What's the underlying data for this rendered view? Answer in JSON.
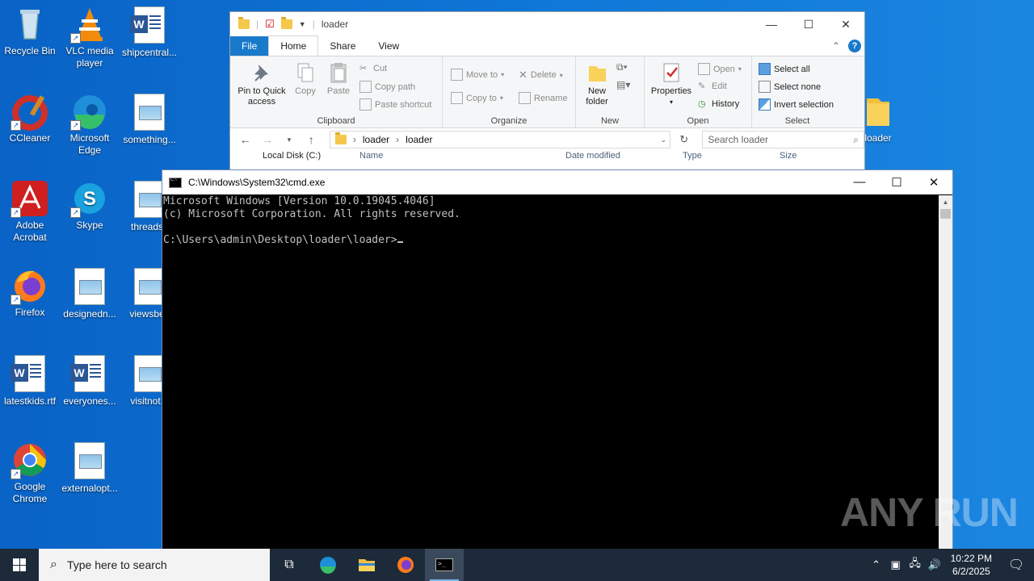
{
  "desktop": {
    "icons": [
      {
        "label": "Recycle Bin",
        "icon": "recycle-bin-icon"
      },
      {
        "label": "VLC media player",
        "icon": "vlc-icon"
      },
      {
        "label": "shipcentral...",
        "icon": "word-doc-icon"
      },
      {
        "label": "CCleaner",
        "icon": "ccleaner-icon"
      },
      {
        "label": "Microsoft Edge",
        "icon": "edge-icon"
      },
      {
        "label": "something...",
        "icon": "image-file-icon"
      },
      {
        "label": "Adobe Acrobat",
        "icon": "acrobat-icon"
      },
      {
        "label": "Skype",
        "icon": "skype-icon"
      },
      {
        "label": "threadsc",
        "icon": "image-file-icon"
      },
      {
        "label": "Firefox",
        "icon": "firefox-icon"
      },
      {
        "label": "designedn...",
        "icon": "image-file-icon"
      },
      {
        "label": "viewsbey",
        "icon": "image-file-icon"
      },
      {
        "label": "latestkids.rtf",
        "icon": "word-doc-icon"
      },
      {
        "label": "everyones...",
        "icon": "word-doc-icon"
      },
      {
        "label": "visitnot.p",
        "icon": "image-file-icon"
      },
      {
        "label": "Google Chrome",
        "icon": "chrome-icon"
      },
      {
        "label": "externalopt...",
        "icon": "image-file-icon"
      },
      {
        "label": "loader",
        "icon": "folder-icon"
      }
    ]
  },
  "explorer": {
    "title": "loader",
    "tabs": {
      "file": "File",
      "home": "Home",
      "share": "Share",
      "view": "View"
    },
    "clipboard": {
      "group": "Clipboard",
      "pin": "Pin to Quick access",
      "copy": "Copy",
      "paste": "Paste",
      "cut": "Cut",
      "copy_path": "Copy path",
      "paste_shortcut": "Paste shortcut"
    },
    "organize": {
      "group": "Organize",
      "move_to": "Move to",
      "copy_to": "Copy to",
      "delete": "Delete",
      "rename": "Rename"
    },
    "new": {
      "group": "New",
      "new_folder": "New folder"
    },
    "open": {
      "group": "Open",
      "properties": "Properties",
      "open": "Open",
      "edit": "Edit",
      "history": "History"
    },
    "select": {
      "group": "Select",
      "select_all": "Select all",
      "select_none": "Select none",
      "invert": "Invert selection"
    },
    "address": {
      "crumb1": "loader",
      "crumb2": "loader"
    },
    "search_placeholder": "Search loader",
    "nav_tree_item": "Local Disk (C:)",
    "columns": {
      "name": "Name",
      "date": "Date modified",
      "type": "Type",
      "size": "Size"
    }
  },
  "cmd": {
    "title": "C:\\Windows\\System32\\cmd.exe",
    "lines": [
      "Microsoft Windows [Version 10.0.19045.4046]",
      "(c) Microsoft Corporation. All rights reserved.",
      "",
      "C:\\Users\\admin\\Desktop\\loader\\loader>"
    ]
  },
  "watermark": "ANY RUN",
  "taskbar": {
    "search_placeholder": "Type here to search",
    "time": "10:22 PM",
    "date": "6/2/2025"
  }
}
